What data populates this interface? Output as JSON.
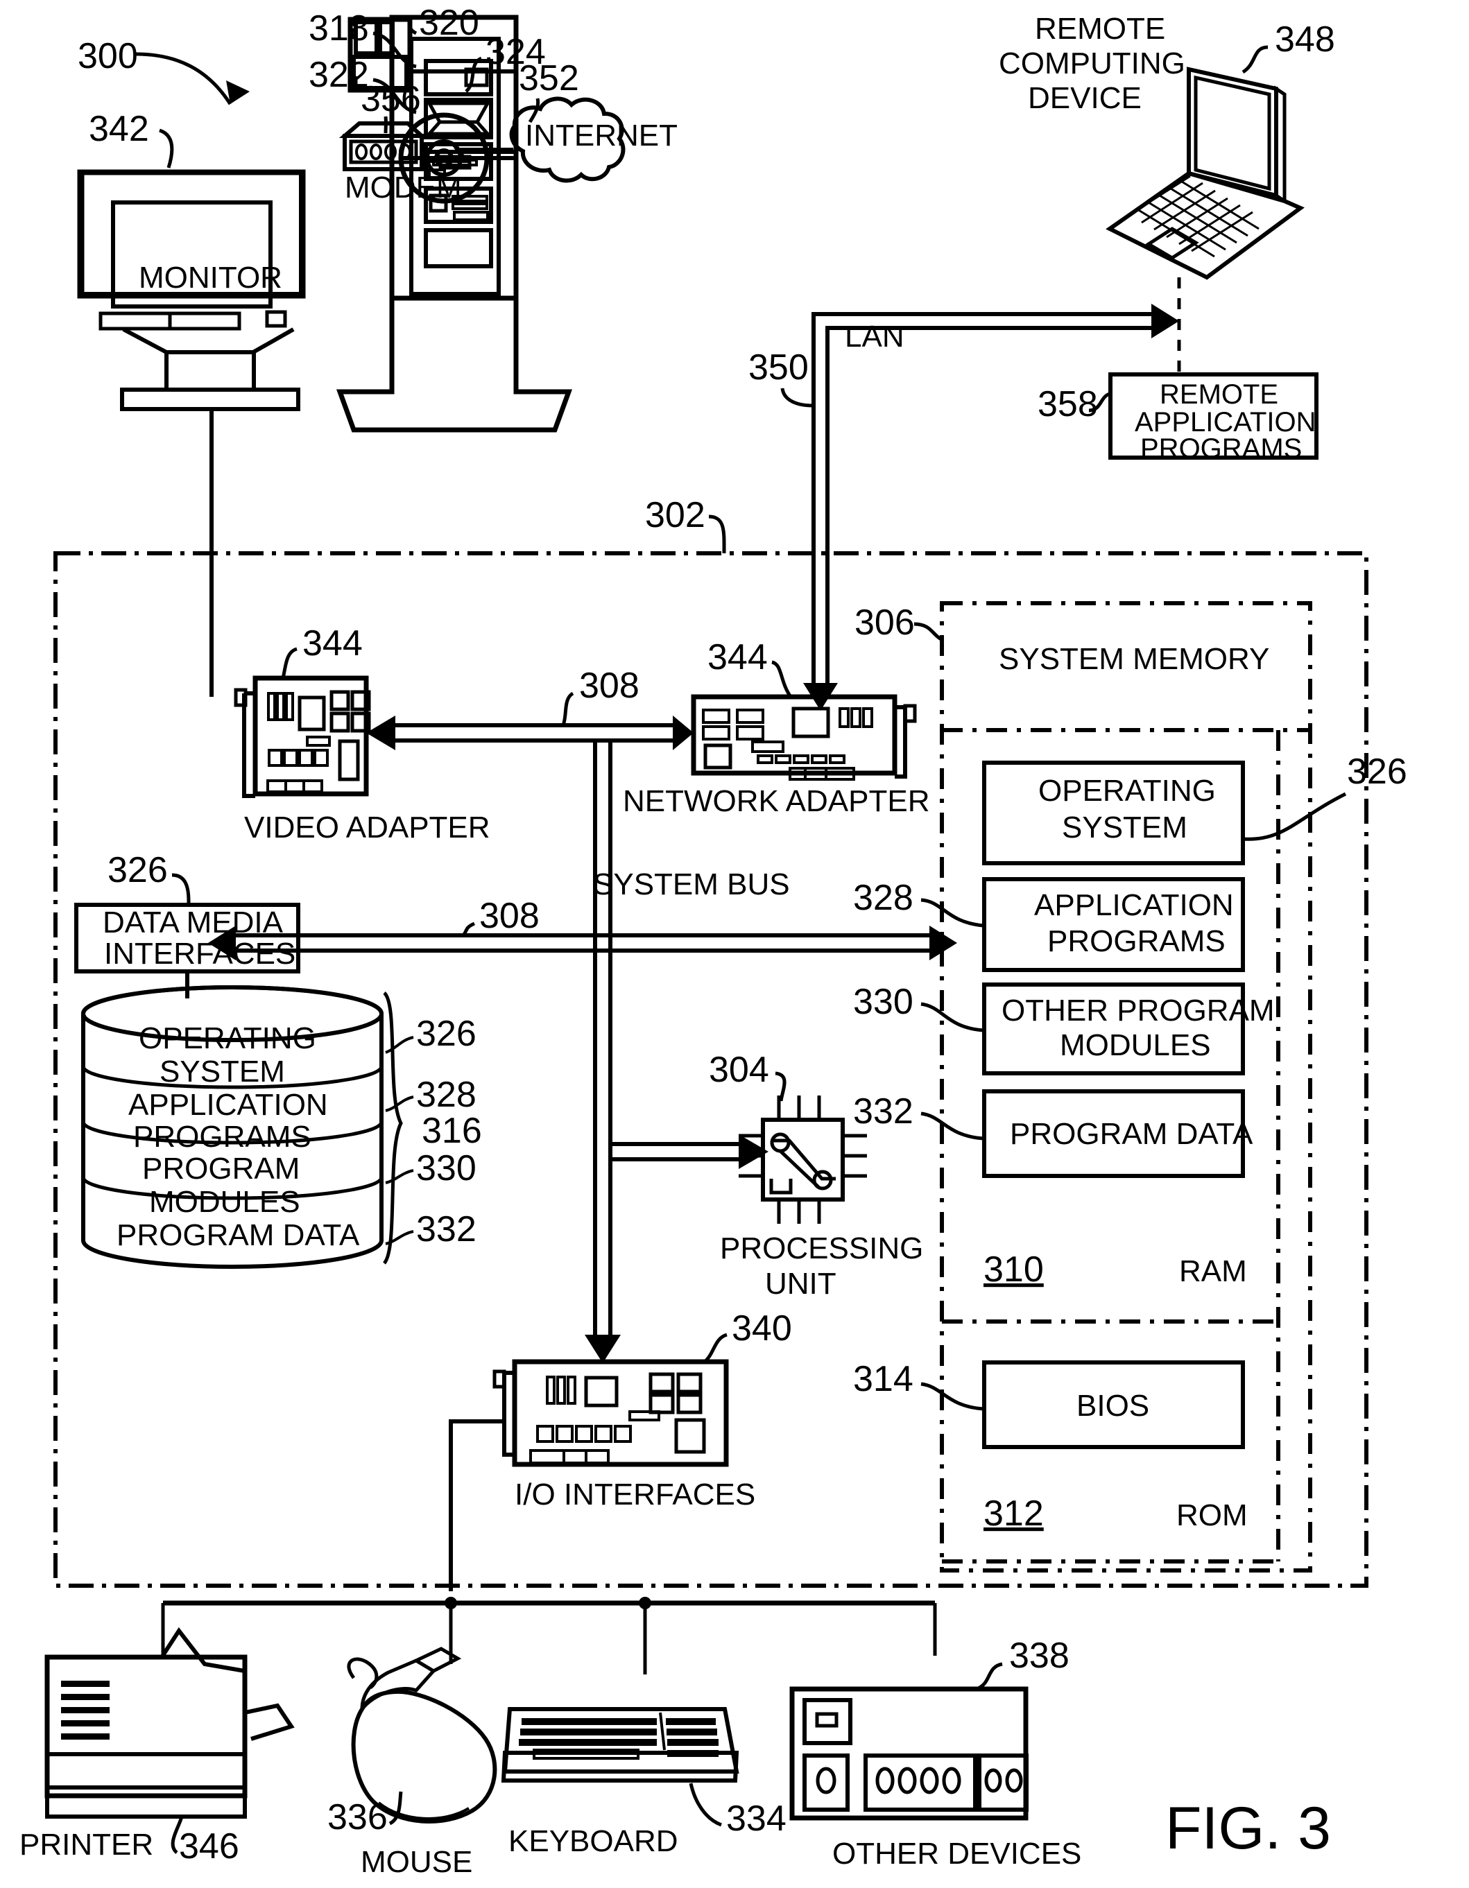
{
  "figure": {
    "caption": "FIG. 3",
    "root_ref": "300"
  },
  "refs": {
    "system": "300",
    "computer_boundary": "302",
    "processing_unit": "304",
    "system_memory": "306",
    "system_bus_a": "308",
    "system_bus_b": "308",
    "ram": "310",
    "rom": "312",
    "bios": "314",
    "disk_brace": "316",
    "tower_upper": "318",
    "floppy_drive": "320",
    "tower_lower": "322",
    "optical_disc": "324",
    "operating_system": "326",
    "data_media_interfaces": "326",
    "disk_operating_system": "326",
    "memory_operating_system": "326",
    "application_programs": "328",
    "disk_application_programs": "328",
    "other_program_modules": "330",
    "disk_program_modules": "330",
    "program_data": "332",
    "disk_program_data": "332",
    "keyboard": "334",
    "mouse": "336",
    "other_devices": "338",
    "io_interfaces": "340",
    "monitor": "342",
    "video_adapter": "344",
    "network_adapter": "344",
    "printer": "346",
    "remote_computing_device": "348",
    "lan": "350",
    "internet": "352",
    "modem": "356",
    "remote_application_programs": "358"
  },
  "labels": {
    "monitor": "MONITOR",
    "modem": "MODEM",
    "internet": "INTERNET",
    "remote_computing_device": [
      "REMOTE",
      "COMPUTING",
      "DEVICE"
    ],
    "lan": "LAN",
    "remote_application_programs": [
      "REMOTE",
      "APPLICATION",
      "PROGRAMS"
    ],
    "system_memory": "SYSTEM MEMORY",
    "video_adapter": "VIDEO ADAPTER",
    "network_adapter": "NETWORK ADAPTER",
    "system_bus": "SYSTEM BUS",
    "data_media_interfaces": [
      "DATA MEDIA",
      "INTERFACES"
    ],
    "memory_operating_system": [
      "OPERATING",
      "SYSTEM"
    ],
    "memory_application_programs": [
      "APPLICATION",
      "PROGRAMS"
    ],
    "memory_other_program_modules": [
      "OTHER PROGRAM",
      "MODULES"
    ],
    "memory_program_data": "PROGRAM DATA",
    "ram": "RAM",
    "rom": "ROM",
    "bios": "BIOS",
    "disk_operating_system": [
      "OPERATING",
      "SYSTEM"
    ],
    "disk_application_programs": [
      "APPLICATION",
      "PROGRAMS"
    ],
    "disk_program_modules": [
      "PROGRAM",
      "MODULES"
    ],
    "disk_program_data": "PROGRAM DATA",
    "processing_unit": [
      "PROCESSING",
      "UNIT"
    ],
    "io_interfaces": "I/O INTERFACES",
    "printer": "PRINTER",
    "mouse": "MOUSE",
    "keyboard": "KEYBOARD",
    "other_devices": "OTHER DEVICES"
  },
  "colors": {
    "stroke": "#000000",
    "background": "#ffffff"
  }
}
